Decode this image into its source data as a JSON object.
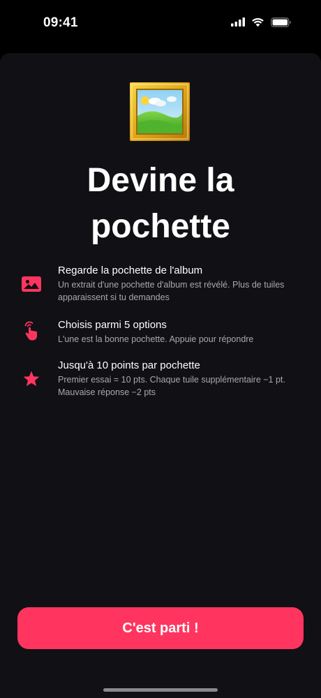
{
  "status_bar": {
    "time": "09:41"
  },
  "onboarding": {
    "hero_icon": "framed-picture-icon",
    "title_line1": "Devine la",
    "title_line2": "pochette",
    "accent_color": "#ff3560",
    "features": [
      {
        "icon": "image-icon",
        "title": "Regarde la pochette de l'album",
        "description": "Un extrait d'une pochette d'album est révélé. Plus de tuiles apparaissent si tu demandes"
      },
      {
        "icon": "tap-hand-icon",
        "title": "Choisis parmi 5 options",
        "description": "L'une est la bonne pochette. Appuie pour répondre"
      },
      {
        "icon": "star-icon",
        "title": "Jusqu'à 10 points par pochette",
        "description": "Premier essai = 10 pts. Chaque tuile supplémentaire −1 pt. Mauvaise réponse −2 pts"
      }
    ],
    "cta_label": "C'est parti !"
  }
}
